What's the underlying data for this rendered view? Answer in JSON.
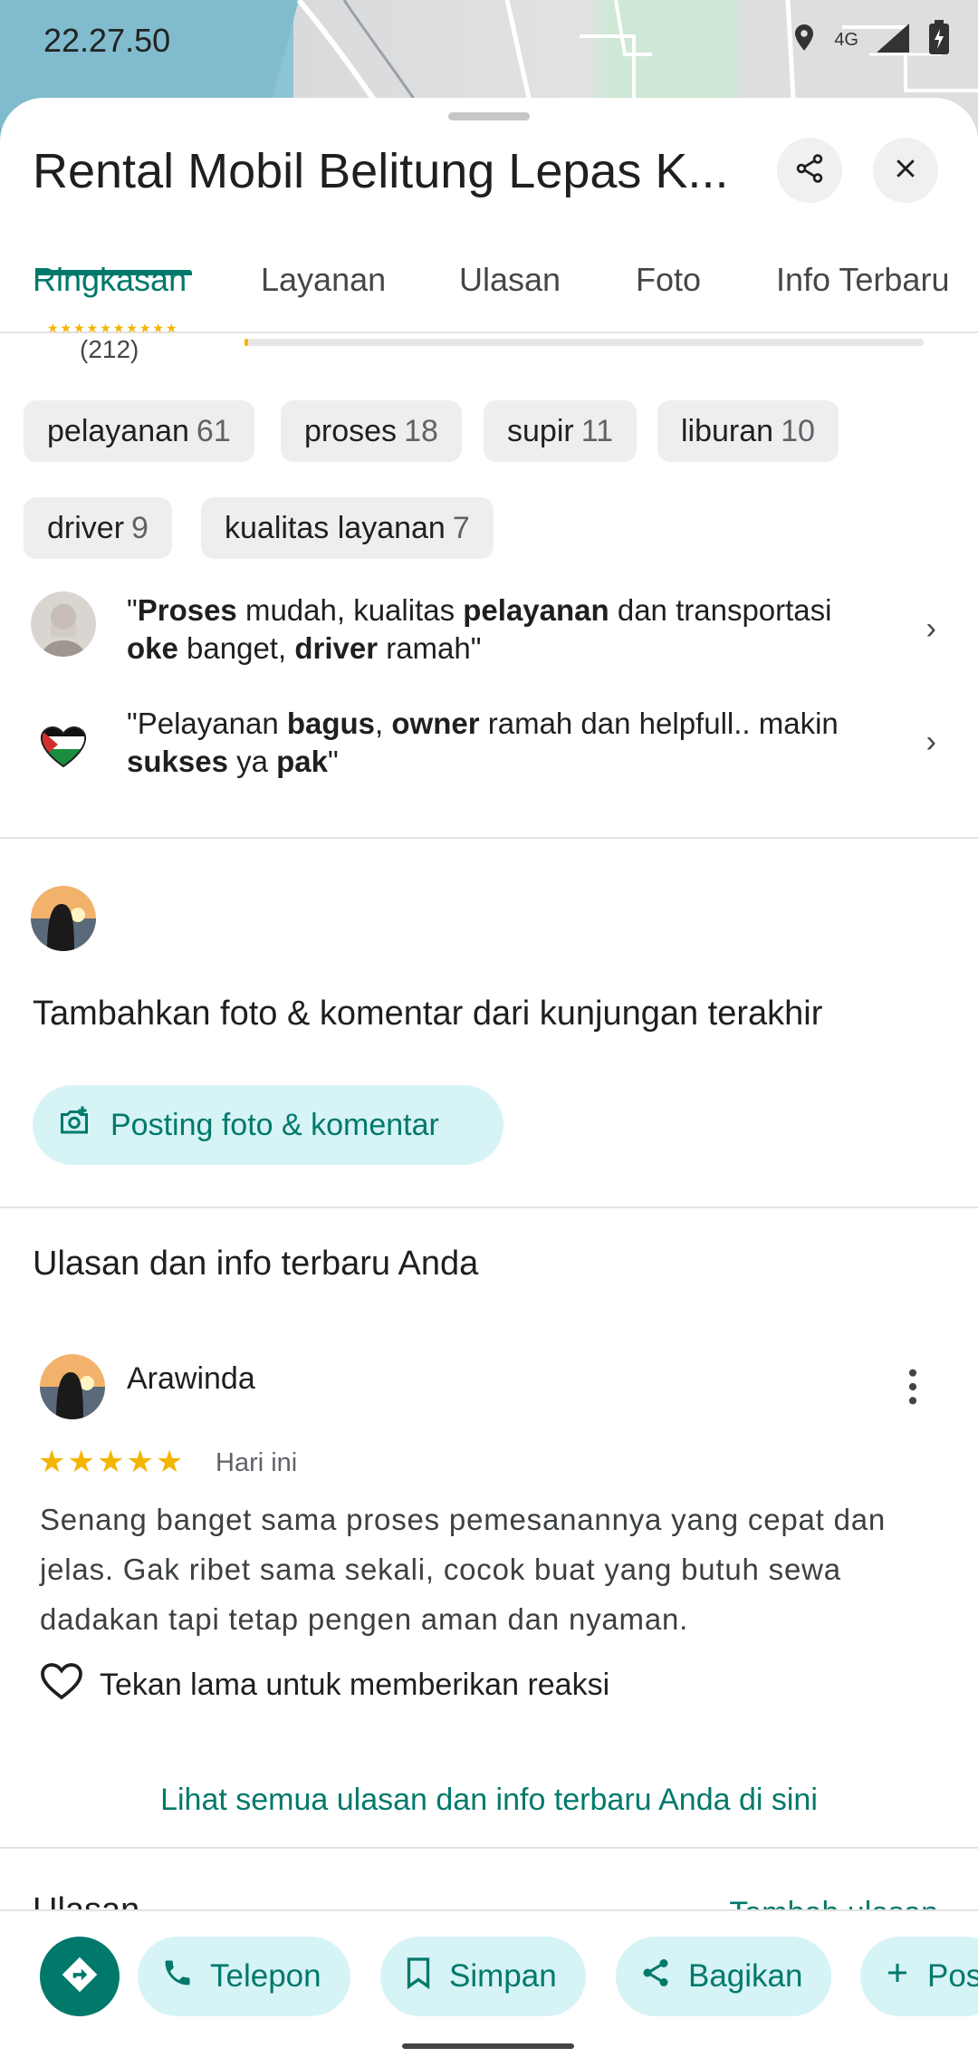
{
  "status_bar": {
    "time": "22.27.50",
    "network": "4G"
  },
  "place": {
    "title": "Rental Mobil Belitung Lepas K..."
  },
  "tabs": [
    "Ringkasan",
    "Layanan",
    "Ulasan",
    "Foto",
    "Info Terbaru"
  ],
  "rating": {
    "count": "(212)",
    "bar_fill": 0.005
  },
  "topic_chips": [
    {
      "label": "pelayanan",
      "count": "61"
    },
    {
      "label": "proses",
      "count": "18"
    },
    {
      "label": "supir",
      "count": "11"
    },
    {
      "label": "liburan",
      "count": "10"
    },
    {
      "label": "driver",
      "count": "9"
    },
    {
      "label": "kualitas layanan",
      "count": "7"
    }
  ],
  "quotes": [
    {
      "segments": [
        [
          "\"",
          ""
        ],
        [
          "Proses",
          "b"
        ],
        [
          " mudah, kualitas ",
          ""
        ],
        [
          "pelayanan",
          "b"
        ],
        [
          " dan transportasi ",
          ""
        ],
        [
          "oke",
          "b"
        ],
        [
          " banget, ",
          ""
        ],
        [
          "driver",
          "b"
        ],
        [
          " ramah\"",
          ""
        ]
      ]
    },
    {
      "segments": [
        [
          "\"Pelayanan ",
          ""
        ],
        [
          "bagus",
          "b"
        ],
        [
          ", ",
          ""
        ],
        [
          "owner",
          "b"
        ],
        [
          " ramah dan helpfull.. makin ",
          ""
        ],
        [
          "sukses",
          "b"
        ],
        [
          " ya ",
          ""
        ],
        [
          "pak",
          "b"
        ],
        [
          "\"",
          ""
        ]
      ]
    }
  ],
  "add_visit": {
    "heading": "Tambahkan foto & komentar dari kunjungan terakhir",
    "button": "Posting foto & komentar"
  },
  "your_reviews": {
    "heading": "Ulasan dan info terbaru Anda",
    "reviewer": "Arawinda",
    "stars": "★★★★★",
    "rating": 5,
    "date": "Hari ini",
    "text": "Senang banget sama proses pemesanannya yang cepat dan jelas. Gak ribet sama sekali, cocok buat yang butuh sewa dadakan tapi tetap pengen aman dan nyaman.",
    "react_hint": "Tekan lama untuk memberikan reaksi",
    "see_all": "Lihat semua ulasan dan info terbaru Anda di sini"
  },
  "reviews_section": {
    "heading": "Ulasan",
    "add_link": "Tambah ulasan"
  },
  "actions": {
    "call": "Telepon",
    "save": "Simpan",
    "share": "Bagikan",
    "post": "Pos"
  },
  "colors": {
    "accent": "#00796b",
    "tonal_button": "#d6f3f6",
    "star": "#f4b400"
  }
}
